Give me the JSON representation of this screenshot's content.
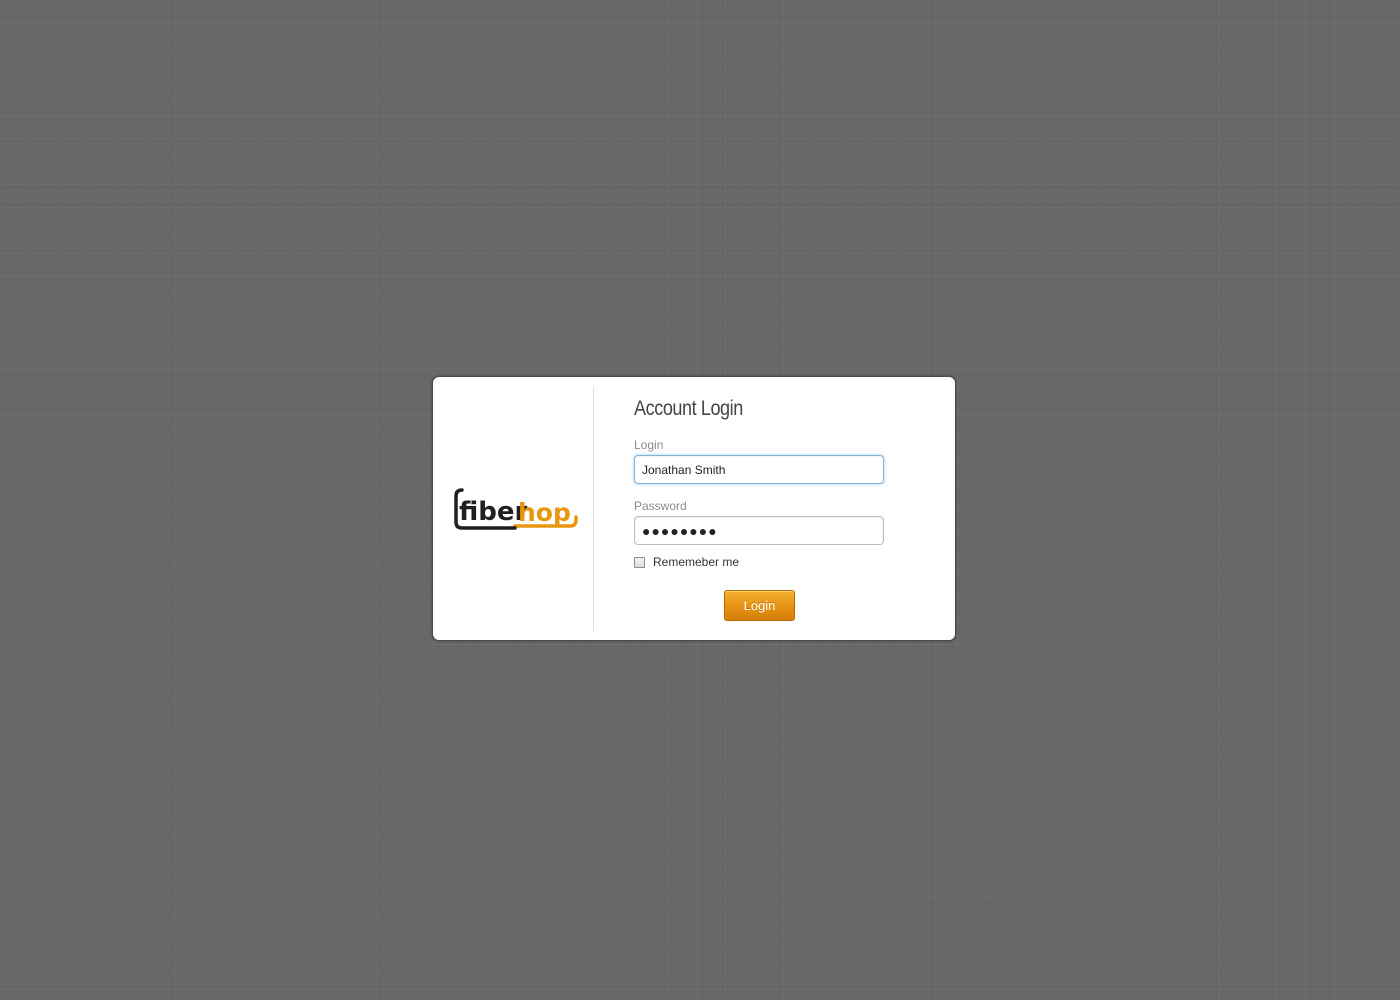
{
  "logo": {
    "text_primary": "fiber",
    "text_secondary": "hop",
    "colors": {
      "primary": "#1f1f1f",
      "accent": "#e8960e"
    }
  },
  "form": {
    "title": "Account Login",
    "login_label": "Login",
    "login_value": "Jonathan Smith",
    "password_label": "Password",
    "password_display": "●●●●●●●●",
    "remember_label": "Rememeber me",
    "remember_checked": false,
    "submit_label": "Login"
  },
  "colors": {
    "background": "#686868",
    "card": "#ffffff",
    "button": "#e69014",
    "focus": "#7fb4d8"
  }
}
